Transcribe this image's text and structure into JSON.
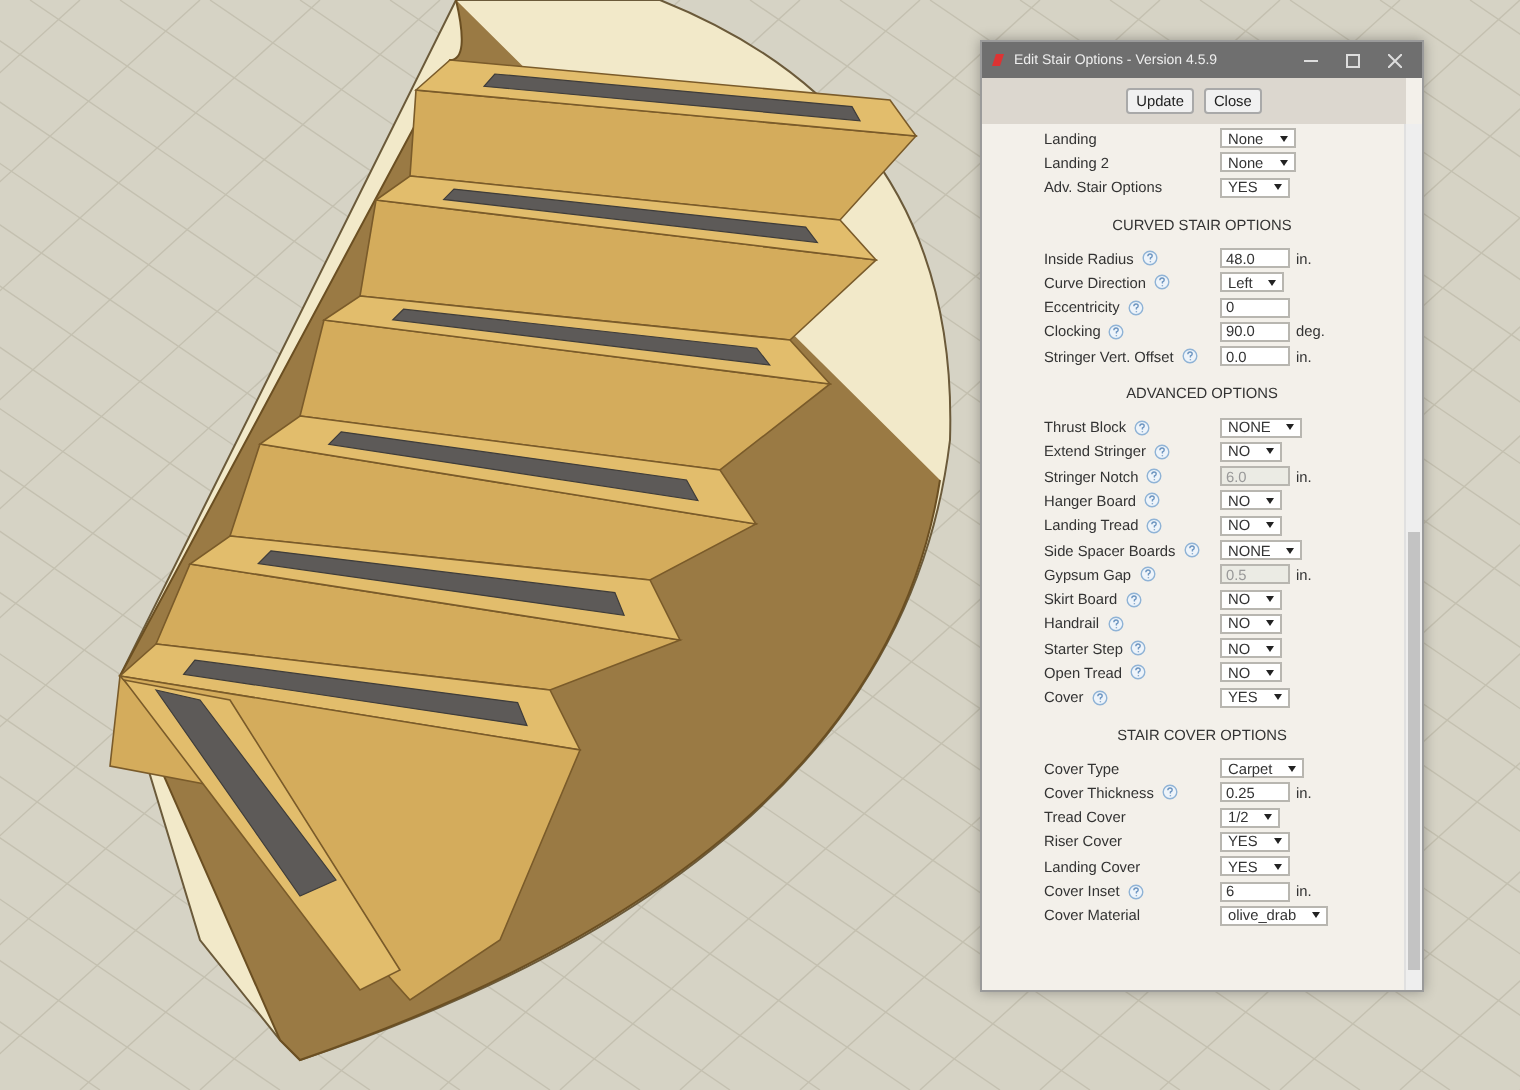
{
  "window": {
    "title": "Edit Stair Options - Version 4.5.9"
  },
  "buttons": [
    "Update",
    "Close"
  ],
  "sections": [
    {
      "rows": [
        {
          "label": "Landing",
          "help": false,
          "kind": "select",
          "value": "None",
          "disabled": false
        },
        {
          "label": "Landing 2",
          "help": false,
          "kind": "select",
          "value": "None",
          "disabled": false
        },
        {
          "label": "Adv. Stair Options",
          "help": false,
          "kind": "select",
          "value": "YES",
          "disabled": false
        }
      ]
    },
    {
      "title": "CURVED STAIR OPTIONS",
      "rows": [
        {
          "label": "Inside Radius",
          "help": true,
          "kind": "input",
          "value": "48.0",
          "unit": "in.",
          "disabled": false
        },
        {
          "label": "Curve Direction",
          "help": true,
          "kind": "select",
          "value": "Left",
          "disabled": false
        },
        {
          "label": "Eccentricity",
          "help": true,
          "kind": "input",
          "value": "0",
          "disabled": false
        },
        {
          "label": "Clocking",
          "help": true,
          "kind": "input",
          "value": "90.0",
          "unit": "deg.",
          "disabled": false
        },
        {
          "label": "Stringer Vert. Offset",
          "help": true,
          "kind": "input",
          "value": "0.0",
          "unit": "in.",
          "disabled": false
        }
      ]
    },
    {
      "title": "ADVANCED OPTIONS",
      "rows": [
        {
          "label": "Thrust Block",
          "help": true,
          "kind": "select",
          "value": "NONE",
          "disabled": false
        },
        {
          "label": "Extend Stringer",
          "help": true,
          "kind": "select",
          "value": "NO",
          "disabled": false
        },
        {
          "label": "Stringer Notch",
          "help": true,
          "kind": "input",
          "value": "6.0",
          "unit": "in.",
          "disabled": true
        },
        {
          "label": "Hanger Board",
          "help": true,
          "kind": "select",
          "value": "NO",
          "disabled": false
        },
        {
          "label": "Landing Tread",
          "help": true,
          "kind": "select",
          "value": "NO",
          "disabled": false
        },
        {
          "label": "Side Spacer Boards",
          "help": true,
          "kind": "select",
          "value": "NONE",
          "disabled": false
        },
        {
          "label": "Gypsum Gap",
          "help": true,
          "kind": "input",
          "value": "0.5",
          "unit": "in.",
          "disabled": true
        },
        {
          "label": "Skirt Board",
          "help": true,
          "kind": "select",
          "value": "NO",
          "disabled": false
        },
        {
          "label": "Handrail",
          "help": true,
          "kind": "select",
          "value": "NO",
          "disabled": false
        },
        {
          "label": "Starter Step",
          "help": true,
          "kind": "select",
          "value": "NO",
          "disabled": false
        },
        {
          "label": "Open Tread",
          "help": true,
          "kind": "select",
          "value": "NO",
          "disabled": false
        },
        {
          "label": "Cover",
          "help": true,
          "kind": "select",
          "value": "YES",
          "disabled": false
        }
      ]
    },
    {
      "title": "STAIR COVER OPTIONS",
      "rows": [
        {
          "label": "Cover Type",
          "help": false,
          "kind": "select",
          "value": "Carpet",
          "disabled": false
        },
        {
          "label": "Cover Thickness",
          "help": true,
          "kind": "input",
          "value": "0.25",
          "unit": "in.",
          "disabled": false
        },
        {
          "label": "Tread Cover",
          "help": false,
          "kind": "select",
          "value": "1/2",
          "disabled": false
        },
        {
          "label": "Riser Cover",
          "help": false,
          "kind": "select",
          "value": "YES",
          "disabled": false
        },
        {
          "label": "Landing Cover",
          "help": false,
          "kind": "select",
          "value": "YES",
          "disabled": false
        },
        {
          "label": "Cover Inset",
          "help": true,
          "kind": "input",
          "value": "6",
          "unit": "in.",
          "disabled": false
        },
        {
          "label": "Cover Material",
          "help": false,
          "kind": "select",
          "value": "olive_drab",
          "disabled": false
        }
      ]
    }
  ]
}
